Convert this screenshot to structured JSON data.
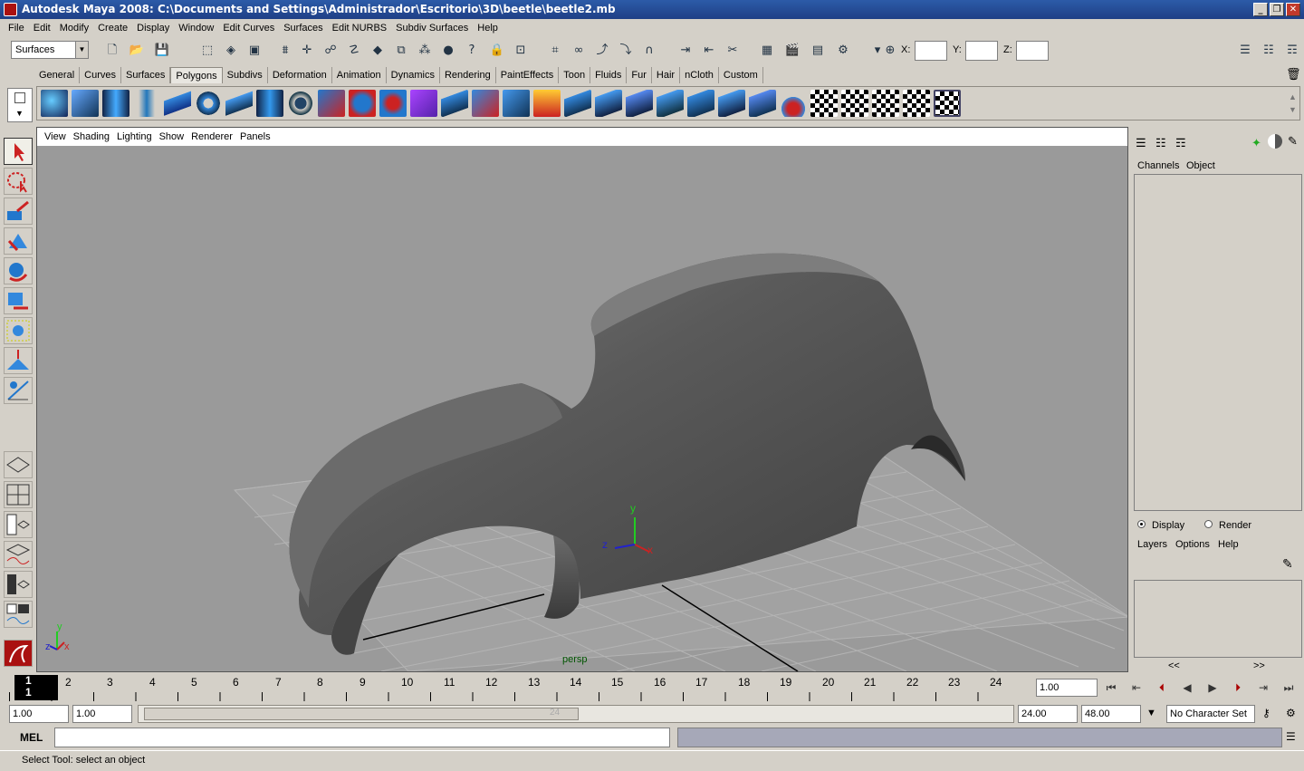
{
  "window": {
    "title": "Autodesk Maya 2008: C:\\Documents and Settings\\Administrador\\Escritorio\\3D\\beetle\\beetle2.mb",
    "min": "_",
    "max": "❐",
    "close": "✕"
  },
  "menu": [
    "File",
    "Edit",
    "Modify",
    "Create",
    "Display",
    "Window",
    "Edit Curves",
    "Surfaces",
    "Edit NURBS",
    "Subdiv Surfaces",
    "Help"
  ],
  "toolbar": {
    "menuset": "Surfaces",
    "x_label": "X:",
    "y_label": "Y:",
    "z_label": "Z:"
  },
  "shelf_tabs": [
    "General",
    "Curves",
    "Surfaces",
    "Polygons",
    "Subdivs",
    "Deformation",
    "Animation",
    "Dynamics",
    "Rendering",
    "PaintEffects",
    "Toon",
    "Fluids",
    "Fur",
    "Hair",
    "nCloth",
    "Custom"
  ],
  "shelf_active": "Polygons",
  "viewport": {
    "menu": [
      "View",
      "Shading",
      "Lighting",
      "Show",
      "Renderer",
      "Panels"
    ],
    "camera": "persp",
    "axis": {
      "y": "y",
      "x": "x",
      "z": "z"
    }
  },
  "channel_box": {
    "tabs": [
      "Channels",
      "Object"
    ]
  },
  "layer_editor": {
    "display": "Display",
    "render": "Render",
    "menu": [
      "Layers",
      "Options",
      "Help"
    ],
    "prev": "<<",
    "next": ">>"
  },
  "timeline": {
    "ticks": [
      "1",
      "2",
      "3",
      "4",
      "5",
      "6",
      "7",
      "8",
      "9",
      "10",
      "11",
      "12",
      "13",
      "14",
      "15",
      "16",
      "17",
      "18",
      "19",
      "20",
      "21",
      "22",
      "23",
      "24"
    ],
    "current": "1",
    "current_field": "1.00"
  },
  "range": {
    "start": "1.00",
    "playback_start": "1.00",
    "range_end_label": "24",
    "playback_end": "24.00",
    "end": "48.00",
    "character_set": "No Character Set"
  },
  "command": {
    "label": "MEL"
  },
  "status": {
    "help": "Select Tool: select an object"
  }
}
